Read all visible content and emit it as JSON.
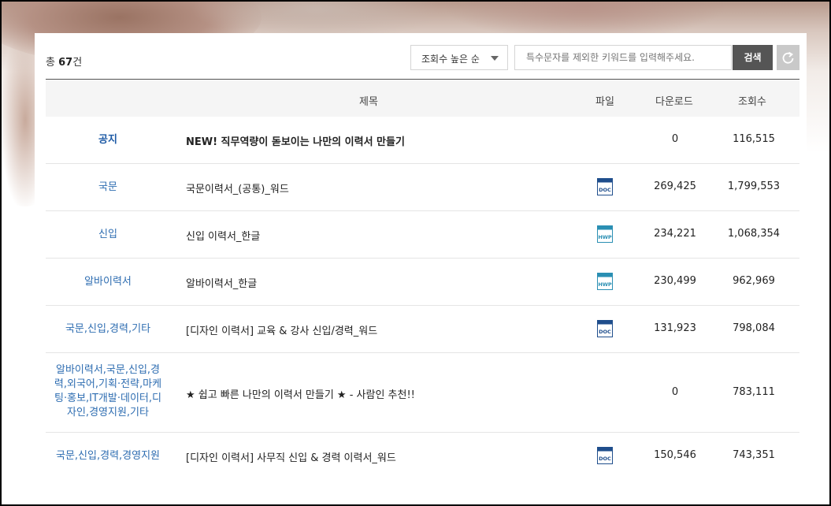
{
  "toolbar": {
    "total_prefix": "총",
    "total_count": "67",
    "total_suffix": "건",
    "sort_selected": "조회수 높은 순",
    "search_placeholder": "특수문자를 제외한 키워드를 입력해주세요.",
    "search_button": "검색"
  },
  "table": {
    "headers": {
      "title": "제목",
      "file": "파일",
      "downloads": "다운로드",
      "views": "조회수"
    },
    "rows": [
      {
        "category": "공지",
        "title": "NEW! 직무역량이 돋보이는 나만의 이력서 만들기",
        "file": "",
        "downloads": "0",
        "views": "116,515"
      },
      {
        "category": "국문",
        "title": "국문이력서_(공통)_워드",
        "file": "DOC",
        "downloads": "269,425",
        "views": "1,799,553"
      },
      {
        "category": "신입",
        "title": "신입 이력서_한글",
        "file": "HWP",
        "downloads": "234,221",
        "views": "1,068,354"
      },
      {
        "category": "알바이력서",
        "title": "알바이력서_한글",
        "file": "HWP",
        "downloads": "230,499",
        "views": "962,969"
      },
      {
        "category": "국문,신입,경력,기타",
        "title": "[디자인 이력서] 교육 & 강사 신입/경력_워드",
        "file": "DOC",
        "downloads": "131,923",
        "views": "798,084"
      },
      {
        "category": "알바이력서,국문,신입,경력,외국어,기획·전략,마케팅·홍보,IT개발·데이터,디자인,경영지원,기타",
        "category_lines": [
          "알바이력서,국문,신입,경",
          "력,외국어,기획·전략,마케",
          "팅·홍보,IT개발·데이터,디",
          "자인,경영지원,기타"
        ],
        "title": "★ 쉽고 빠른 나만의 이력서 만들기 ★ - 사람인 추천!!",
        "file": "",
        "downloads": "0",
        "views": "783,111"
      },
      {
        "category": "국문,신입,경력,경영지원",
        "title": "[디자인 이력서] 사무직 신입 & 경력 이력서_워드",
        "file": "DOC",
        "downloads": "150,546",
        "views": "743,351"
      }
    ]
  },
  "colors": {
    "category_link": "#2e6db1",
    "doc_icon": "#1f4e8c",
    "hwp_icon": "#2a8fb3",
    "search_button": "#555555"
  }
}
